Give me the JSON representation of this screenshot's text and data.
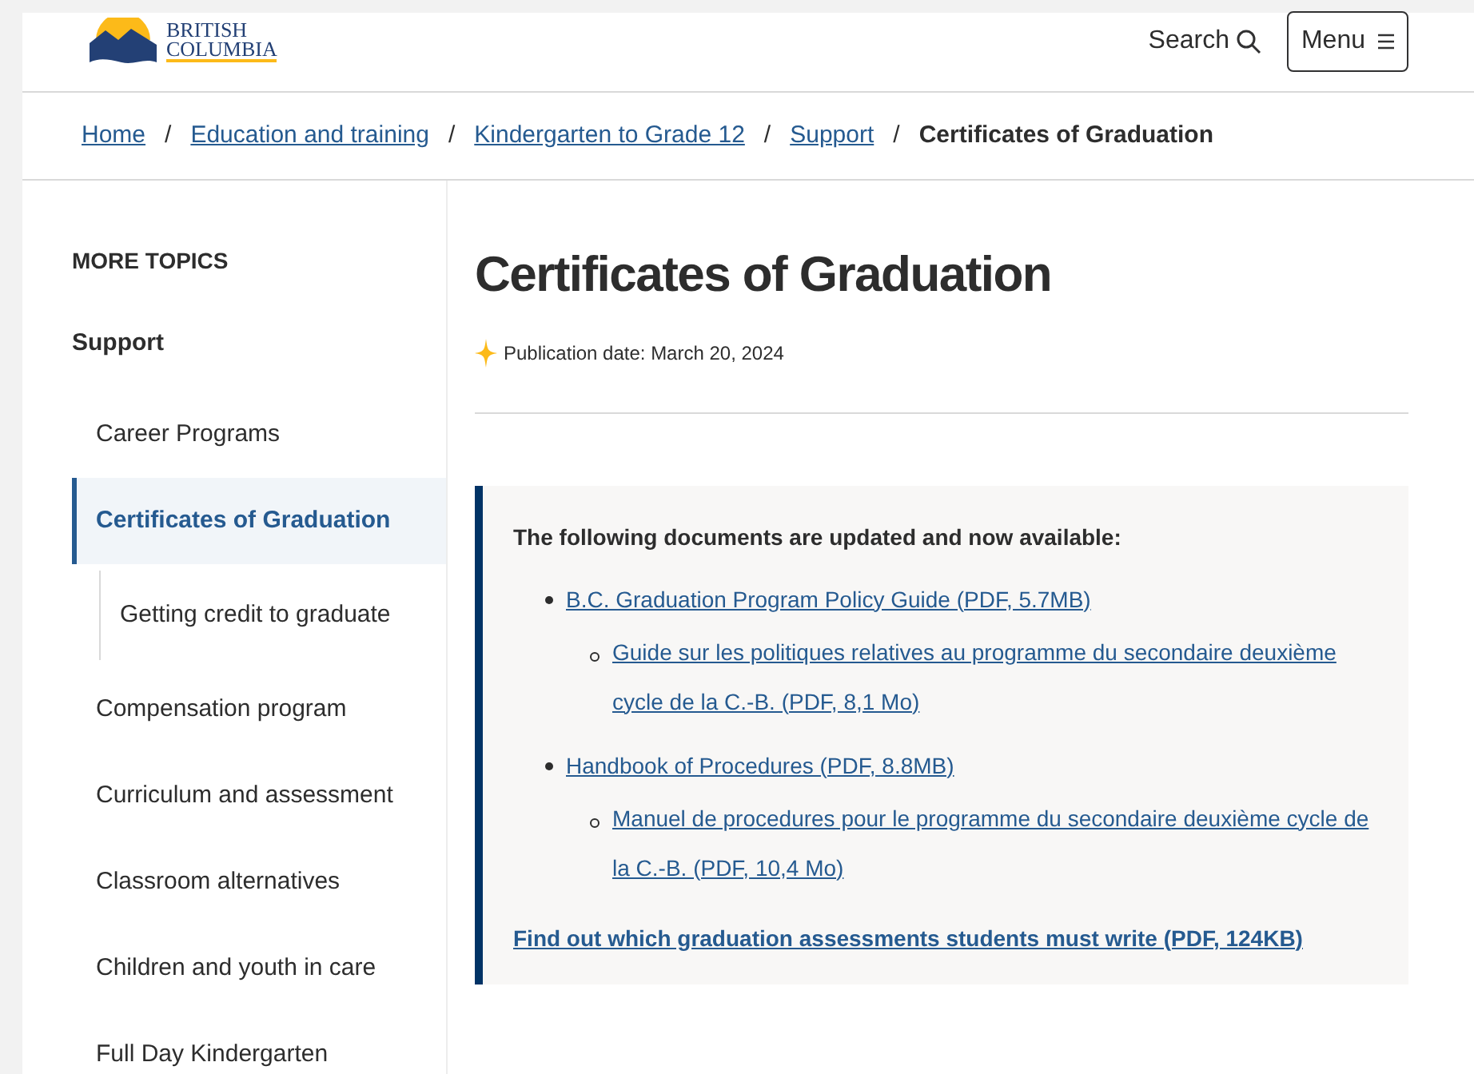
{
  "header": {
    "logo": {
      "line_1": "BRITISH",
      "line_2": "COLUMBIA"
    },
    "search": "Search",
    "menu": "Menu"
  },
  "breadcrumb": [
    {
      "label": "Home",
      "link": true
    },
    {
      "separator": "/",
      "label": "Education and training",
      "link": true
    },
    {
      "separator": "/",
      "label": "Kindergarten to Grade 12",
      "link": true
    },
    {
      "separator": "/",
      "label": "Support",
      "link": true
    },
    {
      "separator": "/",
      "label": "Certificates of Graduation",
      "link": false
    }
  ],
  "sidebar": {
    "heading": "MORE TOPICS",
    "section": "Support",
    "items": [
      {
        "label": "Career Programs",
        "selected": false
      },
      {
        "label": "Certificates of Graduation",
        "selected": true,
        "children": [
          {
            "label": "Getting credit to graduate",
            "selected": false
          }
        ]
      },
      {
        "label": "Compensation program",
        "selected": false
      },
      {
        "label": "Curriculum and assessment",
        "selected": false
      },
      {
        "label": "Classroom alternatives",
        "selected": false
      },
      {
        "label": "Children and youth in care",
        "selected": false
      },
      {
        "label": "Full Day Kindergarten",
        "selected": false
      }
    ]
  },
  "main": {
    "title": "Certificates of Graduation",
    "publication_date": "Publication date: March 20, 2024",
    "callout": {
      "intro": "The following documents are updated and now available:",
      "documents": [
        {
          "label": "B.C. Graduation Program Policy Guide (PDF, 5.7MB)",
          "children": [
            {
              "label": "Guide sur les politiques relatives au programme du secondaire deuxième cycle de la C.-B. (PDF, 8,1 Mo)"
            }
          ]
        },
        {
          "label": "Handbook of Procedures (PDF, 8.8MB)",
          "children": [
            {
              "label": "Manuel de procedures pour le programme du secondaire deuxième cycle de la C.-B. (PDF, 10,4 Mo)"
            }
          ]
        }
      ],
      "footer_link": "Find out which graduation assessments students must write (PDF, 124KB)"
    }
  }
}
